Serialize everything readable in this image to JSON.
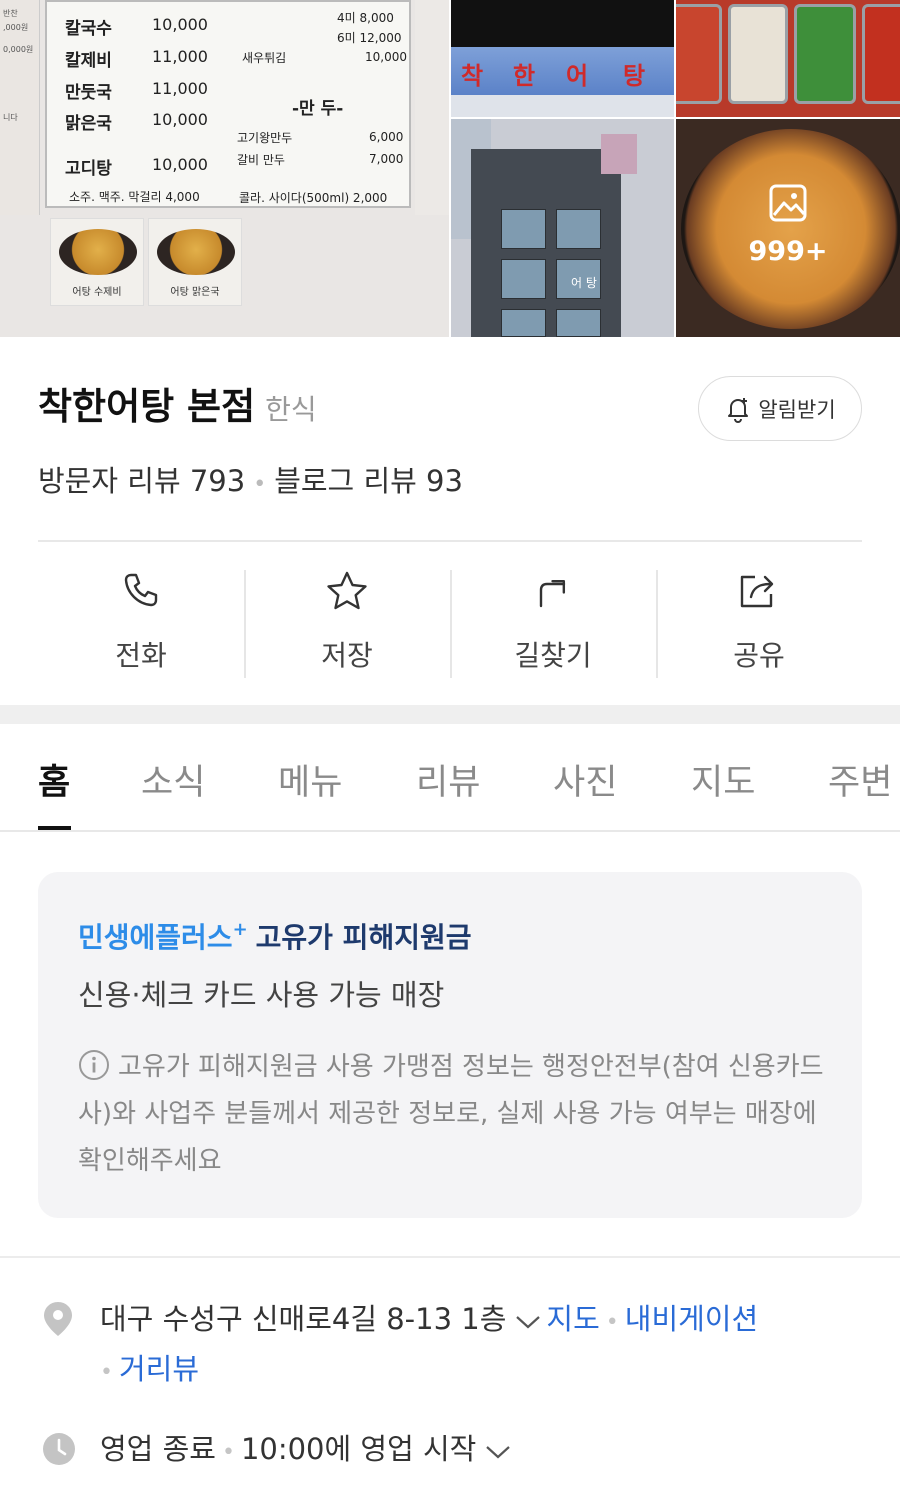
{
  "gallery": {
    "menu_board": {
      "items": [
        {
          "name": "칼국수",
          "price": "10,000"
        },
        {
          "name": "칼제비",
          "price": "11,000"
        },
        {
          "name": "만둣국",
          "price": "11,000"
        },
        {
          "name": "맑은국",
          "price": "10,000"
        },
        {
          "name": "고디탕",
          "price": "10,000"
        }
      ],
      "drinks": "소주. 맥주. 막걸리 4,000",
      "fried_top": "4미  8,000",
      "fried_top2": "6미 12,000",
      "fried_shrimp": "새우튀김",
      "fried_shrimp_price": "10,000",
      "dumpling_header": "-만 두-",
      "dumplings": [
        {
          "name": "고기왕만두",
          "price": "6,000"
        },
        {
          "name": "갈비 만두",
          "price": "7,000"
        }
      ],
      "soda": "콜라. 사이다(500ml) 2,000",
      "pot_captions": [
        "어탕 수제비",
        "어탕 맑은국"
      ]
    },
    "sign_text": [
      "착",
      "한",
      "어",
      "탕"
    ],
    "building_label": "어 탕",
    "photo_count": "999+"
  },
  "place": {
    "name": "착한어탕 본점",
    "category": "한식",
    "alert_label": "알림받기",
    "visitor_reviews": "방문자 리뷰 793",
    "blog_reviews": "블로그 리뷰 93"
  },
  "actions": [
    {
      "label": "전화",
      "icon": "phone-icon"
    },
    {
      "label": "저장",
      "icon": "star-icon"
    },
    {
      "label": "길찾기",
      "icon": "directions-icon"
    },
    {
      "label": "공유",
      "icon": "share-icon"
    }
  ],
  "tabs": [
    "홈",
    "소식",
    "메뉴",
    "리뷰",
    "사진",
    "지도",
    "주변"
  ],
  "active_tab": "홈",
  "promo": {
    "brand": "민생에플러스",
    "plus": "+",
    "title": "고유가 피해지원금",
    "subtitle": "신용·체크 카드 사용 가능 매장",
    "note": "고유가 피해지원금 사용 가맹점 정보는 행정안전부(참여 신용카드사)와 사업주 분들께서 제공한 정보로, 실제 사용 가능 여부는 매장에 확인해주세요"
  },
  "address": {
    "text": "대구 수성구 신매로4길 8-13 1층",
    "map_link": "지도",
    "navigation_link": "내비게이션",
    "street_view_link": "거리뷰"
  },
  "hours": {
    "status": "영업 종료",
    "next": "10:00에 영업 시작"
  },
  "colors": {
    "link_blue": "#2a6bd6",
    "promo_blue": "#2d8ce8",
    "promo_navy": "#1e3a6d",
    "card_bg": "#f4f4f6"
  }
}
